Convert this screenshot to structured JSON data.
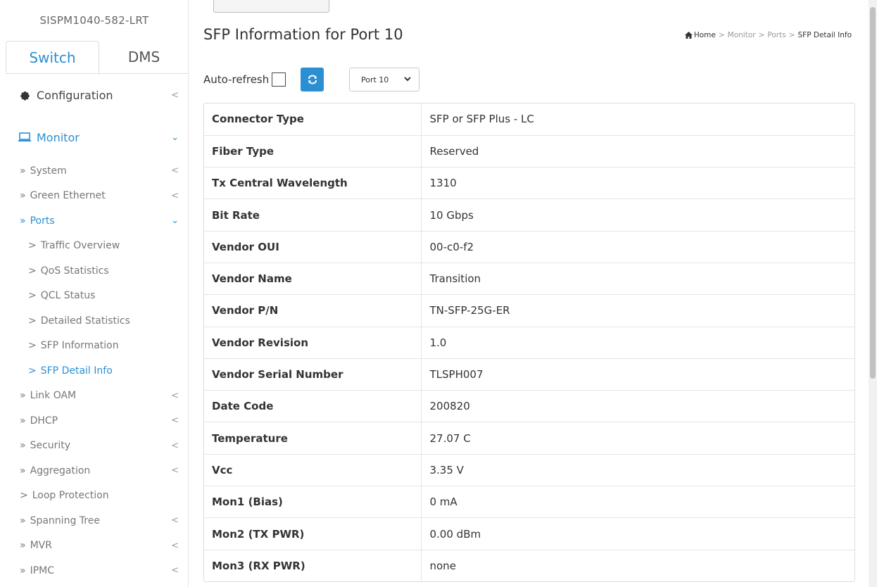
{
  "device": {
    "name": "SISPM1040-582-LRT"
  },
  "tabs": [
    {
      "label": "Switch"
    },
    {
      "label": "DMS"
    }
  ],
  "nav": {
    "configuration": "Configuration",
    "monitor": "Monitor",
    "items": [
      {
        "label": "System",
        "arrow": "»",
        "chevron": "<"
      },
      {
        "label": "Green Ethernet",
        "arrow": "»",
        "chevron": "<"
      },
      {
        "label": "Ports",
        "arrow": "»",
        "chevron": "⌄"
      },
      {
        "label": "Traffic Overview",
        "arrow": ">"
      },
      {
        "label": "QoS Statistics",
        "arrow": ">"
      },
      {
        "label": "QCL Status",
        "arrow": ">"
      },
      {
        "label": "Detailed Statistics",
        "arrow": ">"
      },
      {
        "label": "SFP Information",
        "arrow": ">"
      },
      {
        "label": "SFP Detail Info",
        "arrow": ">"
      },
      {
        "label": "Link OAM",
        "arrow": "»",
        "chevron": "<"
      },
      {
        "label": "DHCP",
        "arrow": "»",
        "chevron": "<"
      },
      {
        "label": "Security",
        "arrow": "»",
        "chevron": "<"
      },
      {
        "label": "Aggregation",
        "arrow": "»",
        "chevron": "<"
      },
      {
        "label": "Loop Protection",
        "arrow": ">"
      },
      {
        "label": "Spanning Tree",
        "arrow": "»",
        "chevron": "<"
      },
      {
        "label": "MVR",
        "arrow": "»",
        "chevron": "<"
      },
      {
        "label": "IPMC",
        "arrow": "»",
        "chevron": "<"
      }
    ]
  },
  "page": {
    "title": "SFP Information for  Port 10"
  },
  "breadcrumb": {
    "home": "Home",
    "sep": ">",
    "items": [
      "Monitor",
      "Ports"
    ],
    "current": "SFP Detail Info"
  },
  "controls": {
    "auto_refresh_label": "Auto-refresh",
    "auto_refresh_checked": false,
    "port_select_value": "Port 10"
  },
  "table": {
    "rows": [
      {
        "label": "Connector Type",
        "value": "SFP or SFP Plus - LC"
      },
      {
        "label": "Fiber Type",
        "value": "Reserved"
      },
      {
        "label": "Tx Central Wavelength",
        "value": "1310"
      },
      {
        "label": "Bit Rate",
        "value": "10 Gbps"
      },
      {
        "label": "Vendor OUI",
        "value": "00-c0-f2"
      },
      {
        "label": "Vendor Name",
        "value": "Transition"
      },
      {
        "label": "Vendor P/N",
        "value": "TN-SFP-25G-ER"
      },
      {
        "label": "Vendor Revision",
        "value": "1.0"
      },
      {
        "label": "Vendor Serial Number",
        "value": "TLSPH007"
      },
      {
        "label": "Date Code",
        "value": "200820"
      },
      {
        "label": "Temperature",
        "value": "27.07 C"
      },
      {
        "label": "Vcc",
        "value": "3.35 V"
      },
      {
        "label": "Mon1 (Bias)",
        "value": "0 mA"
      },
      {
        "label": "Mon2 (TX PWR)",
        "value": "0.00 dBm"
      },
      {
        "label": "Mon3 (RX PWR)",
        "value": "none"
      }
    ]
  },
  "colors": {
    "accent": "#2a8fd3",
    "text": "#333333",
    "muted": "#777777",
    "border": "#dddddd"
  }
}
